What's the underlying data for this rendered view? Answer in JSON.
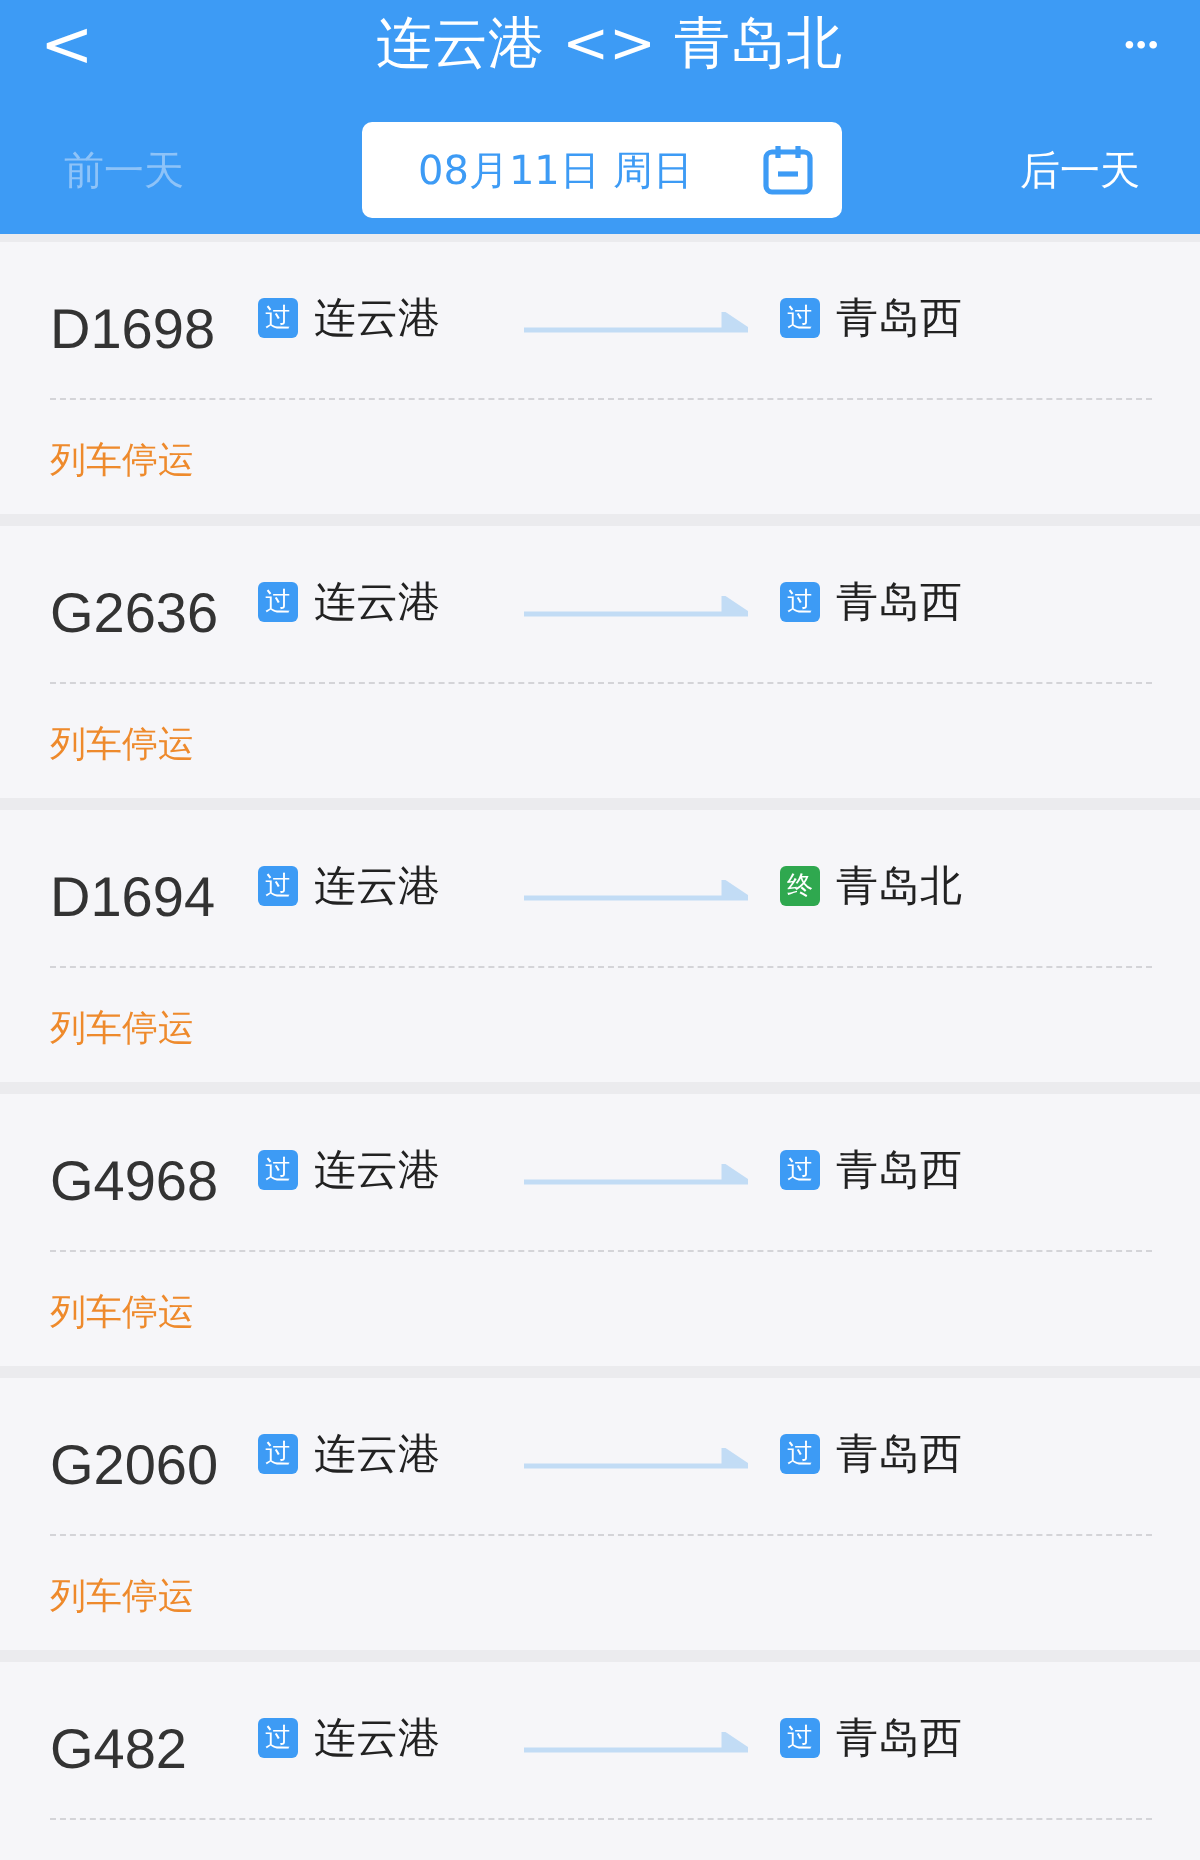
{
  "header": {
    "back": "<",
    "title": "连云港 <> 青岛北",
    "more": "•••"
  },
  "date_bar": {
    "prev": {
      "label": "前一天",
      "disabled": true
    },
    "date": "08月11日 周日",
    "next": {
      "label": "后一天",
      "disabled": false
    }
  },
  "trains": [
    {
      "number": "D1698",
      "from": {
        "badge": "过",
        "kind": "pass",
        "name": "连云港"
      },
      "to": {
        "badge": "过",
        "kind": "pass",
        "name": "青岛西"
      },
      "status": "列车停运"
    },
    {
      "number": "G2636",
      "from": {
        "badge": "过",
        "kind": "pass",
        "name": "连云港"
      },
      "to": {
        "badge": "过",
        "kind": "pass",
        "name": "青岛西"
      },
      "status": "列车停运"
    },
    {
      "number": "D1694",
      "from": {
        "badge": "过",
        "kind": "pass",
        "name": "连云港"
      },
      "to": {
        "badge": "终",
        "kind": "terminal",
        "name": "青岛北"
      },
      "status": "列车停运"
    },
    {
      "number": "G4968",
      "from": {
        "badge": "过",
        "kind": "pass",
        "name": "连云港"
      },
      "to": {
        "badge": "过",
        "kind": "pass",
        "name": "青岛西"
      },
      "status": "列车停运"
    },
    {
      "number": "G2060",
      "from": {
        "badge": "过",
        "kind": "pass",
        "name": "连云港"
      },
      "to": {
        "badge": "过",
        "kind": "pass",
        "name": "青岛西"
      },
      "status": "列车停运"
    },
    {
      "number": "G482",
      "from": {
        "badge": "过",
        "kind": "pass",
        "name": "连云港"
      },
      "to": {
        "badge": "过",
        "kind": "pass",
        "name": "青岛西"
      }
    }
  ]
}
